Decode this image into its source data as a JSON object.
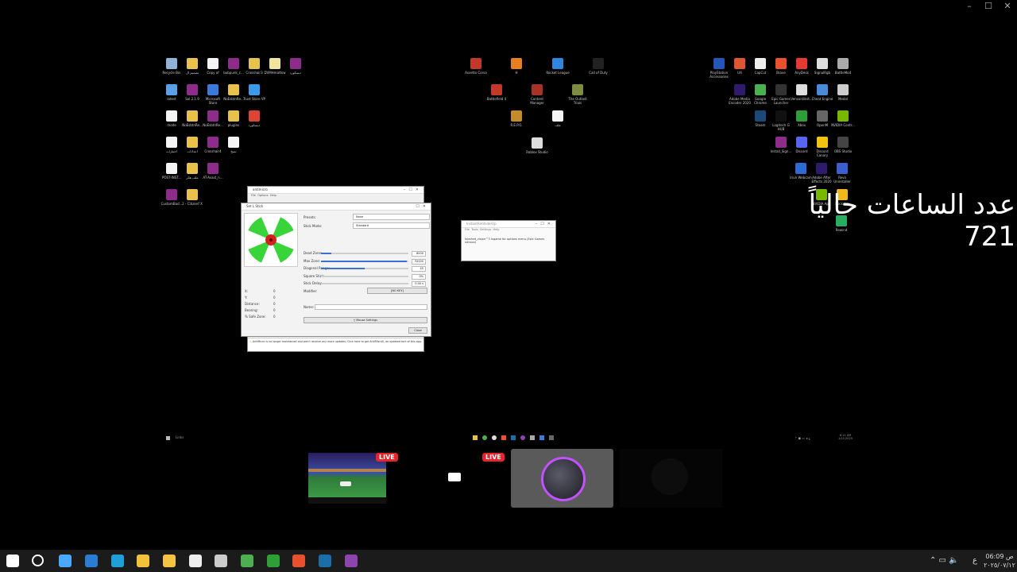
{
  "window_controls": {
    "minimize": "–",
    "maximize": "☐",
    "close": "✕"
  },
  "desktop_left": [
    {
      "label": "Recycle Bin",
      "color": "#8fb3d9"
    },
    {
      "label": "تصميم ال",
      "color": "#e8c24a"
    },
    {
      "label": "Copy of",
      "color": "#f4f4f4"
    },
    {
      "label": "bobpunk_c...",
      "color": "#8e2c8b"
    },
    {
      "label": "Crosshair3",
      "color": "#e8c24a"
    },
    {
      "label": "DVMHmattsw",
      "color": "#f2e3a0"
    },
    {
      "label": "ديسكورد",
      "color": "#8e2c8b"
    },
    {
      "label": "latest",
      "color": "#5aa0e8"
    },
    {
      "label": "Sol.2.1.9",
      "color": "#8e2c8b"
    },
    {
      "label": "Microsoft Store",
      "color": "#3c7ad9"
    },
    {
      "label": "NoEsbtnRe...",
      "color": "#e8c24a"
    },
    {
      "label": "Trust Store VP",
      "color": "#3c9ae8"
    },
    {
      "label": "mode",
      "color": "#f4f4f4"
    },
    {
      "label": "NoEsbtnRe...",
      "color": "#e8c24a"
    },
    {
      "label": "NoEsbtnRe...",
      "color": "#8e2c8b"
    },
    {
      "label": "plugins",
      "color": "#e8c24a"
    },
    {
      "label": "ديسكورد",
      "color": "#dd4433"
    },
    {
      "label": "اختبارات",
      "color": "#f4f4f4"
    },
    {
      "label": "اعدادات",
      "color": "#e8c24a"
    },
    {
      "label": "Crosshair4",
      "color": "#8e2c8b"
    },
    {
      "label": "نسخ",
      "color": "#f4f4f4"
    },
    {
      "label": "POST-INST...",
      "color": "#f4f4f4"
    },
    {
      "label": "ملف هكر",
      "color": "#e8c24a"
    },
    {
      "label": "AT-Avast_n...",
      "color": "#8e2c8b"
    },
    {
      "label": "CustomBad...",
      "color": "#8e2c8b"
    },
    {
      "label": "2 - Citizenf X",
      "color": "#e8c24a"
    }
  ],
  "desktop_mid": [
    {
      "label": "Assetto Corsa",
      "color": "#c0392b"
    },
    {
      "label": "H",
      "color": "#e67e22"
    },
    {
      "label": "Rocket League",
      "color": "#2e86de"
    },
    {
      "label": "Call of Duty",
      "color": "#222"
    },
    {
      "label": "Battlefield 4",
      "color": "#c0392b"
    },
    {
      "label": "Content Manager",
      "color": "#a93226"
    },
    {
      "label": "The Outlast Trials",
      "color": "#7d8c40"
    },
    {
      "label": "R.E.P.O.",
      "color": "#c58b2a"
    },
    {
      "label": "ملف",
      "color": "#f4f4f4"
    },
    {
      "label": "Roblox Studio",
      "color": "#ddd"
    }
  ],
  "desktop_right": [
    {
      "label": "PlayStation Accessories",
      "color": "#2456b8"
    },
    {
      "label": "UA",
      "color": "#dd5533"
    },
    {
      "label": "CapCut",
      "color": "#eee"
    },
    {
      "label": "Brave",
      "color": "#e8512e"
    },
    {
      "label": "AnyDesk",
      "color": "#e53935"
    },
    {
      "label": "SignalRgb",
      "color": "#ddd"
    },
    {
      "label": "BattleMod",
      "color": "#aaa"
    },
    {
      "label": "Adobe Media Encoder 2020",
      "color": "#2f1a6b"
    },
    {
      "label": "Google Chrome",
      "color": "#4caf50"
    },
    {
      "label": "Epic Games Launcher",
      "color": "#333"
    },
    {
      "label": "VencordInst...",
      "color": "#ddd"
    },
    {
      "label": "Cheat Engine",
      "color": "#4a8bd9"
    },
    {
      "label": "Medal",
      "color": "#ccc"
    },
    {
      "label": "Steam",
      "color": "#1b4a7a"
    },
    {
      "label": "Logitech G HUB",
      "color": "#111"
    },
    {
      "label": "Xbox",
      "color": "#2e9e37"
    },
    {
      "label": "OpenM",
      "color": "#666"
    },
    {
      "label": "NVIDIA Contr...",
      "color": "#76b900"
    },
    {
      "label": "Install_Sign...",
      "color": "#8e2c8b"
    },
    {
      "label": "Discord",
      "color": "#5865f2"
    },
    {
      "label": "Discord Canary",
      "color": "#f1c40f"
    },
    {
      "label": "OBS Studio",
      "color": "#444"
    },
    {
      "label": "Iriun Webcam",
      "color": "#2d6ad8"
    },
    {
      "label": "Adobe After Effects 2020",
      "color": "#2f1a6b"
    },
    {
      "label": "Revo Uninstaller",
      "color": "#3b5fcf"
    },
    {
      "label": "NVIDIA App",
      "color": "#76b900"
    },
    {
      "label": "Rockstar",
      "color": "#f1b81c"
    },
    {
      "label": "Rewind",
      "color": "#27ae60"
    }
  ],
  "overlay_text": "عدد الساعات حالياً 721",
  "antimicro": {
    "title": "antimicro",
    "menu": [
      "File",
      "Options",
      "Help"
    ],
    "footer": "AntiMicro is no longer maintained and won't receive any more updates. Click here to get AntiMicroX, an updated fork of this app."
  },
  "stick_dialog": {
    "title": "Set L Stick",
    "presets_label": "Presets:",
    "presets_value": "None",
    "mode_label": "Stick Mode:",
    "mode_value": "Standard",
    "rows": [
      {
        "label": "Dead Zone:",
        "value": "8000",
        "fill": 0.12
      },
      {
        "label": "Max Zone:",
        "value": "32000",
        "fill": 0.98
      },
      {
        "label": "Diagonal Range:",
        "value": "45",
        "fill": 0.5
      },
      {
        "label": "Square Stick:",
        "value": "0%",
        "fill": 0.0
      },
      {
        "label": "Stick Delay:",
        "value": "0.00 s",
        "fill": 0.0
      }
    ],
    "modifier_label": "Modifier:",
    "modifier_value": "[NO KEY]",
    "stats": [
      {
        "label": "X:",
        "value": "0"
      },
      {
        "label": "Y:",
        "value": "0"
      },
      {
        "label": "Distance:",
        "value": "0"
      },
      {
        "label": "Bearing:",
        "value": "0"
      },
      {
        "label": "% Safe Zone:",
        "value": "0"
      }
    ],
    "name_label": "Name:",
    "mouse_button": "Mouse Settings",
    "close_button": "Close"
  },
  "small_window": {
    "title": "InstantAntihiderUp",
    "menu": [
      "File",
      "Tools",
      "Settings",
      "Help"
    ],
    "message": "Injected_vision™3 ingame for options menu (Epic Games version)"
  },
  "inner_taskbar": {
    "start_label": "Links",
    "time": "6:11 AM",
    "date": "1/11/2025"
  },
  "panels": [
    {
      "type": "game",
      "live": "LIVE"
    },
    {
      "type": "screen",
      "live": "LIVE"
    },
    {
      "type": "avatar",
      "live": ""
    },
    {
      "type": "empty",
      "live": ""
    }
  ],
  "taskbar": {
    "icons": [
      {
        "name": "windows-start",
        "color": "#ffffff"
      },
      {
        "name": "search",
        "color": "#ffffff"
      },
      {
        "name": "copilot",
        "color": "#4aa8ff"
      },
      {
        "name": "outlook",
        "color": "#2b7cd3"
      },
      {
        "name": "edge",
        "color": "#1fa0d8"
      },
      {
        "name": "store",
        "color": "#f3c13a"
      },
      {
        "name": "explorer",
        "color": "#f5c542"
      },
      {
        "name": "capture",
        "color": "#eeeeee"
      },
      {
        "name": "clock",
        "color": "#cccccc"
      },
      {
        "name": "chrome",
        "color": "#4caf50"
      },
      {
        "name": "xbox-bar",
        "color": "#2e9e37"
      },
      {
        "name": "brave",
        "color": "#e8512e"
      },
      {
        "name": "steam",
        "color": "#1b6ea8"
      },
      {
        "name": "discord",
        "color": "#8e44ad"
      }
    ],
    "lang": "ع",
    "time": "06:09 ص",
    "date": "٢٠٢٥/٠٧/١٢"
  }
}
